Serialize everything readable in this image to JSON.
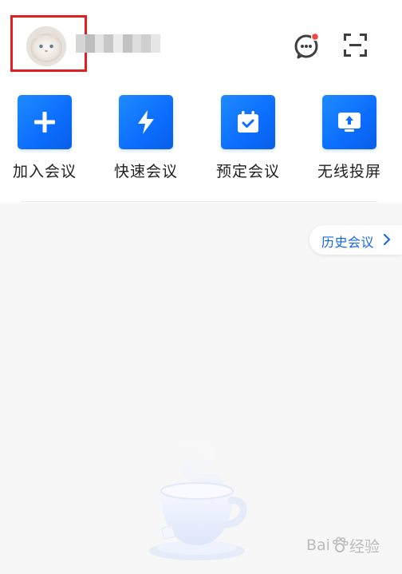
{
  "header": {
    "avatar_name": "avatar",
    "username_blurred": "████████",
    "message_icon": "message-dots-icon",
    "scan_icon": "scan-icon",
    "colors": {
      "highlight": "#e02020",
      "badge": "#f0483e"
    }
  },
  "actions": [
    {
      "label": "加入会议",
      "icon": "plus-icon"
    },
    {
      "label": "快速会议",
      "icon": "lightning-icon"
    },
    {
      "label": "预定会议",
      "icon": "calendar-check-icon"
    },
    {
      "label": "无线投屏",
      "icon": "screen-cast-icon"
    }
  ],
  "history": {
    "label": "历史会议",
    "icon": "chevron-right-icon"
  },
  "watermark": {
    "logo_text": "Bai",
    "suffix": "经验"
  },
  "theme": {
    "accent": "#0b6dff",
    "background": "#f7f7f8"
  }
}
